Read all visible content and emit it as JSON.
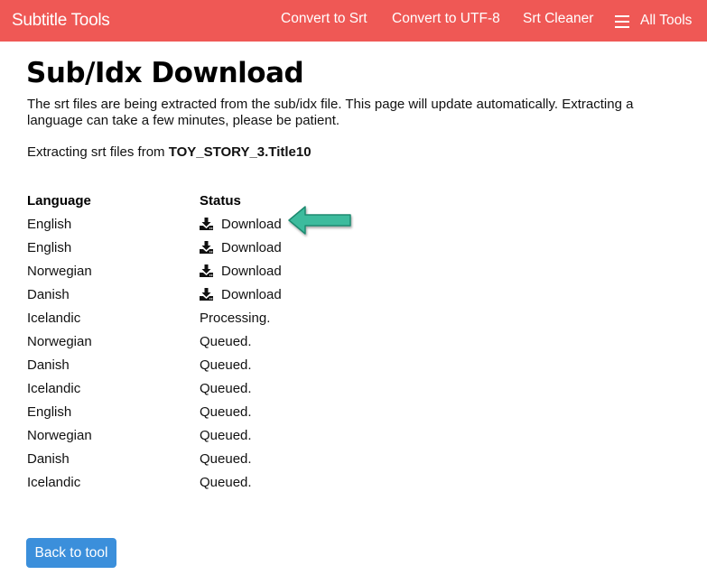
{
  "navbar": {
    "brand": "Subtitle Tools",
    "links": [
      {
        "label": "Convert to Srt"
      },
      {
        "label": "Convert to UTF-8"
      },
      {
        "label": "Srt Cleaner"
      }
    ],
    "all_tools": {
      "label": "All Tools",
      "icon": "hamburger-menu-icon"
    },
    "color": "#ef5855"
  },
  "page": {
    "title": "Sub/Idx Download",
    "intro": "The srt files are being extracted from the sub/idx file. This page will update automatically. Extracting a language can take a few minutes, please be patient.",
    "extract_prefix": "Extracting srt files from ",
    "filename": "TOY_STORY_3.Title10"
  },
  "table": {
    "headers": {
      "language": "Language",
      "status": "Status"
    },
    "rows": [
      {
        "language": "English",
        "status": "Download",
        "downloadable": true
      },
      {
        "language": "English",
        "status": "Download",
        "downloadable": true
      },
      {
        "language": "Norwegian",
        "status": "Download",
        "downloadable": true
      },
      {
        "language": "Danish",
        "status": "Download",
        "downloadable": true
      },
      {
        "language": "Icelandic",
        "status": "Processing.",
        "downloadable": false
      },
      {
        "language": "Norwegian",
        "status": "Queued.",
        "downloadable": false
      },
      {
        "language": "Danish",
        "status": "Queued.",
        "downloadable": false
      },
      {
        "language": "Icelandic",
        "status": "Queued.",
        "downloadable": false
      },
      {
        "language": "English",
        "status": "Queued.",
        "downloadable": false
      },
      {
        "language": "Norwegian",
        "status": "Queued.",
        "downloadable": false
      },
      {
        "language": "Danish",
        "status": "Queued.",
        "downloadable": false
      },
      {
        "language": "Icelandic",
        "status": "Queued.",
        "downloadable": false
      }
    ]
  },
  "annotation": {
    "icon": "arrow-pointer-icon",
    "color": "#3dbb9d"
  },
  "back_button": {
    "label": "Back to tool",
    "color": "#3b8fdb"
  }
}
